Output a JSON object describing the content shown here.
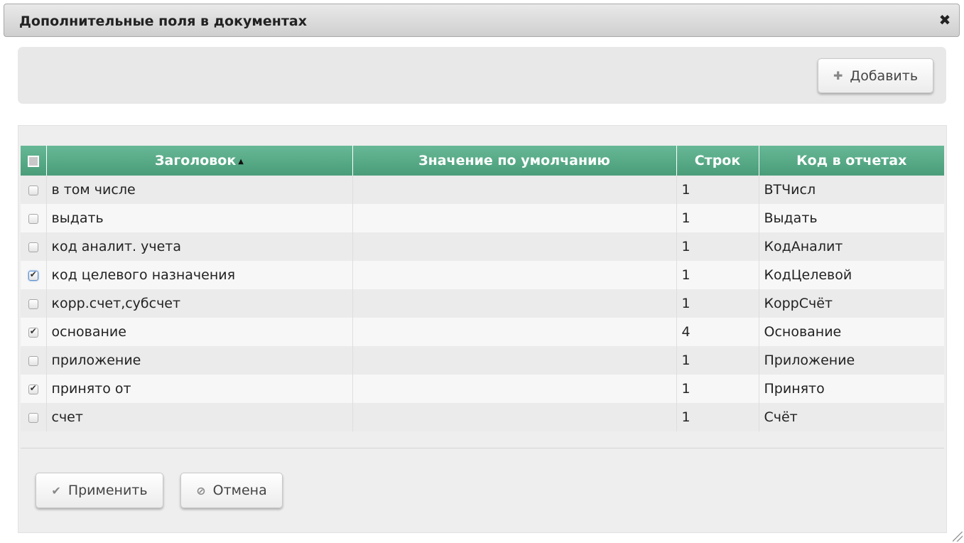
{
  "dialog": {
    "title": "Дополнительные поля в документах",
    "close_icon": "close-icon"
  },
  "toolbar": {
    "add_label": "Добавить",
    "add_icon": "plus-icon"
  },
  "grid": {
    "columns": {
      "select": "",
      "title": "Заголовок",
      "default_value": "Значение по умолчанию",
      "lines": "Строк",
      "report_code": "Код в отчетах"
    },
    "sort": {
      "column": "title",
      "direction": "ascending"
    },
    "rows": [
      {
        "checked": false,
        "title": "в том числе",
        "default_value": "",
        "lines": "1",
        "report_code": "ВТЧисл"
      },
      {
        "checked": false,
        "title": "выдать",
        "default_value": "",
        "lines": "1",
        "report_code": "Выдать"
      },
      {
        "checked": false,
        "title": "код аналит. учета",
        "default_value": "",
        "lines": "1",
        "report_code": "КодАналит"
      },
      {
        "checked": true,
        "title": "код целевого назначения",
        "default_value": "",
        "lines": "1",
        "report_code": "КодЦелевой"
      },
      {
        "checked": false,
        "title": "корр.счет,субсчет",
        "default_value": "",
        "lines": "1",
        "report_code": "КоррСчёт"
      },
      {
        "checked": true,
        "title": "основание",
        "default_value": "",
        "lines": "4",
        "report_code": "Основание"
      },
      {
        "checked": false,
        "title": "приложение",
        "default_value": "",
        "lines": "1",
        "report_code": "Приложение"
      },
      {
        "checked": true,
        "title": "принято от",
        "default_value": "",
        "lines": "1",
        "report_code": "Принято"
      },
      {
        "checked": false,
        "title": "счет",
        "default_value": "",
        "lines": "1",
        "report_code": "Счёт"
      }
    ]
  },
  "footer": {
    "apply_label": "Применить",
    "apply_icon": "checkmark-icon",
    "cancel_label": "Отмена",
    "cancel_icon": "ban-icon"
  },
  "colors": {
    "header_green": "#5aad89",
    "titlebar_gray": "#d9d9d9",
    "panel_gray": "#eeeeee"
  }
}
